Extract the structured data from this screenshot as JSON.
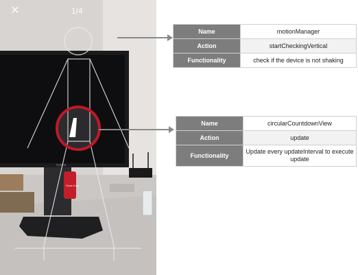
{
  "phone": {
    "close_icon": "close-icon",
    "close_glyph": "✕",
    "page_counter": "1/4",
    "monitor_brand": "iiyama",
    "can_brand": "Coca-Cola"
  },
  "annotations": [
    {
      "id": "motion-manager",
      "rows": [
        {
          "key": "Name",
          "value": "motionManager"
        },
        {
          "key": "Action",
          "value": "startCheckingVertical"
        },
        {
          "key": "Functionality",
          "value": "check if the device is not shaking"
        }
      ]
    },
    {
      "id": "circular-countdown",
      "rows": [
        {
          "key": "Name",
          "value": "circularCountdownView"
        },
        {
          "key": "Action",
          "value": "update"
        },
        {
          "key": "Functionality",
          "value": "Update every updateInterval to execute update"
        }
      ]
    }
  ],
  "colors": {
    "table_header_bg": "#7d7d7d",
    "ring_red": "#c0182a",
    "arrow_gray": "#8a8a8a"
  }
}
